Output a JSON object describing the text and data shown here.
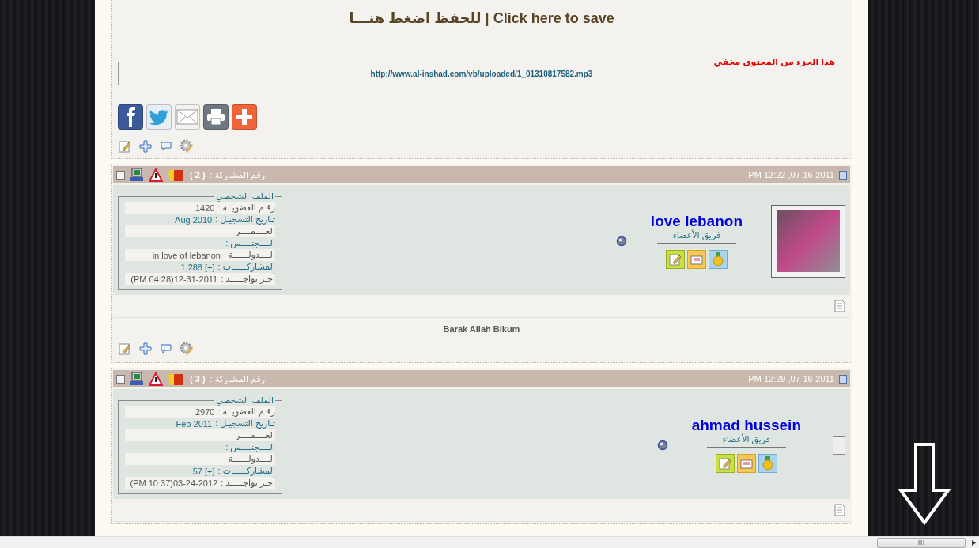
{
  "save_link": "Click here to save | للحفظ اضغط هنـــا",
  "hidden_box": {
    "legend": "هذا الجزء من المحتوى مخفي",
    "url": "http://www.al-inshad.com/vb/uploaded/1_01310817582.mp3"
  },
  "posts": [
    {
      "number_label": "رقم المشاركة :",
      "number": "( 2 )",
      "checked": false,
      "date": "PM 12:22 ,07-16-2011",
      "username": "love lebanon",
      "rank": "فريق الأعضاء",
      "avatar": {
        "kind": "photo"
      },
      "profile": {
        "title": "الملف الشخصي",
        "rows": [
          {
            "label": "رقـم العضويــة :",
            "value": "1420"
          },
          {
            "label": "تـاريخ التسجيـل :",
            "value": "Aug 2010"
          },
          {
            "label": "العــــمــــر :"
          },
          {
            "label": "الــــجنــــس :"
          },
          {
            "label": "الــــدولــــــة :",
            "value": "in love of lebanon"
          },
          {
            "label": "المشاركـــــات :",
            "value": "1,288 [+]"
          },
          {
            "label": "آخـر تواجـــــد :",
            "value": "(PM 04:28)12-31-2011"
          }
        ]
      },
      "message": "Barak Allah Bikum"
    },
    {
      "number_label": "رقم المشاركة :",
      "number": "( 3 )",
      "checked": false,
      "date": "PM 12:29 ,07-16-2011",
      "username": "ahmad hussein",
      "rank": "فريق الأعضاء",
      "avatar": {
        "kind": "broken"
      },
      "profile": {
        "title": "الملف الشخصي",
        "rows": [
          {
            "label": "رقـم العضويــة :",
            "value": "2970"
          },
          {
            "label": "تـاريخ التسجيـل :",
            "value": "Feb 2011"
          },
          {
            "label": "العــــمــــر :"
          },
          {
            "label": "الــــجنــــس :"
          },
          {
            "label": "الــــدولــــــة :"
          },
          {
            "label": "المشاركـــــات :",
            "value": "57 [+]"
          },
          {
            "label": "آخـر تواجـــــد :",
            "value": "(PM 10:37)03-24-2012"
          }
        ]
      }
    }
  ]
}
